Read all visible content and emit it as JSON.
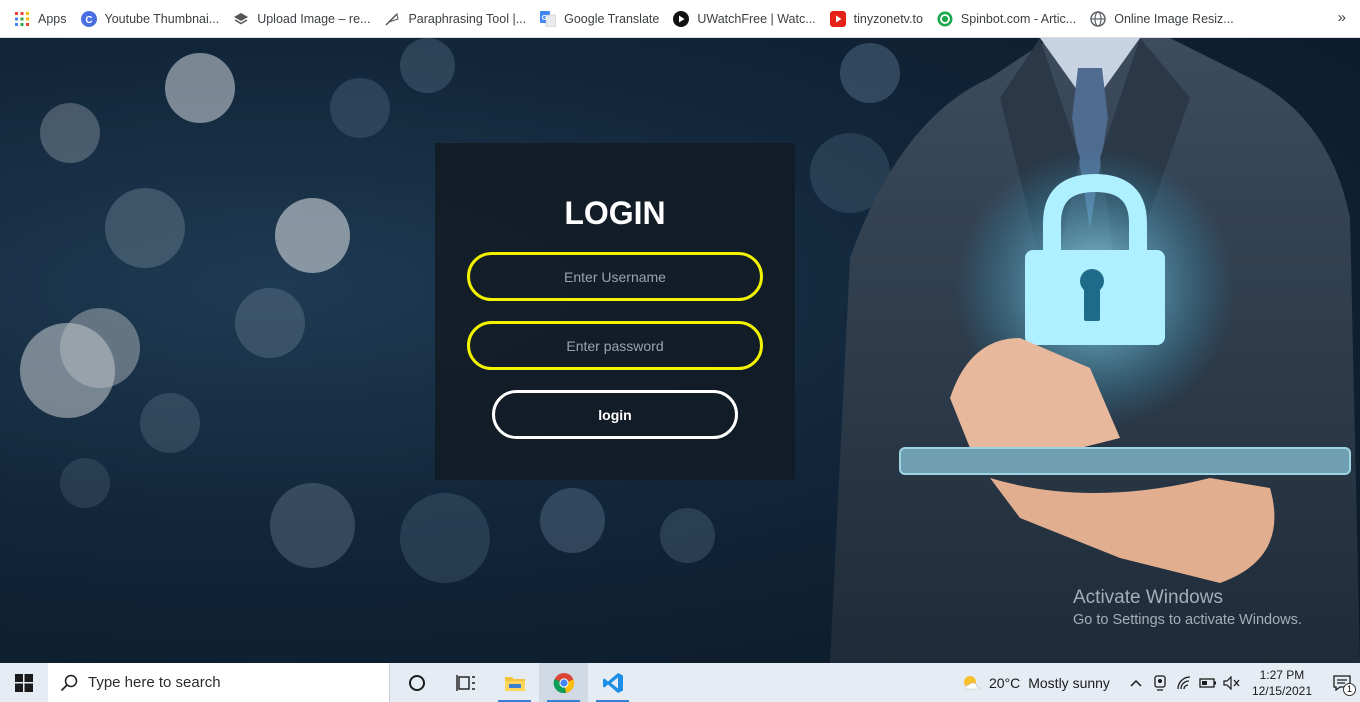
{
  "bookmarks": [
    {
      "label": "Apps",
      "icon": "apps-grid-icon"
    },
    {
      "label": "Youtube Thumbnai...",
      "icon": "c-logo-icon"
    },
    {
      "label": "Upload Image – re...",
      "icon": "stack-icon"
    },
    {
      "label": "Paraphrasing Tool |...",
      "icon": "feather-icon"
    },
    {
      "label": "Google Translate",
      "icon": "google-translate-icon"
    },
    {
      "label": "UWatchFree | Watc...",
      "icon": "play-circle-icon"
    },
    {
      "label": "tinyzonetv.to",
      "icon": "youtube-play-icon"
    },
    {
      "label": "Spinbot.com - Artic...",
      "icon": "spinbot-icon"
    },
    {
      "label": "Online Image Resiz...",
      "icon": "globe-icon"
    }
  ],
  "more_label": "»",
  "login": {
    "title": "LOGIN",
    "username_placeholder": "Enter Username",
    "password_placeholder": "Enter password",
    "button_label": "login"
  },
  "watermark": {
    "title": "Activate Windows",
    "subtitle": "Go to Settings to activate Windows."
  },
  "taskbar": {
    "search_placeholder": "Type here to search",
    "weather_temp": "20°C",
    "weather_desc": "Mostly sunny",
    "time": "1:27 PM",
    "date": "12/15/2021",
    "notification_count": "1"
  },
  "colors": {
    "field_border": "#f3f300",
    "card_bg": "#121a22",
    "lock_glow": "#7fe3ff",
    "taskbar_bg": "#e6ecf3"
  }
}
